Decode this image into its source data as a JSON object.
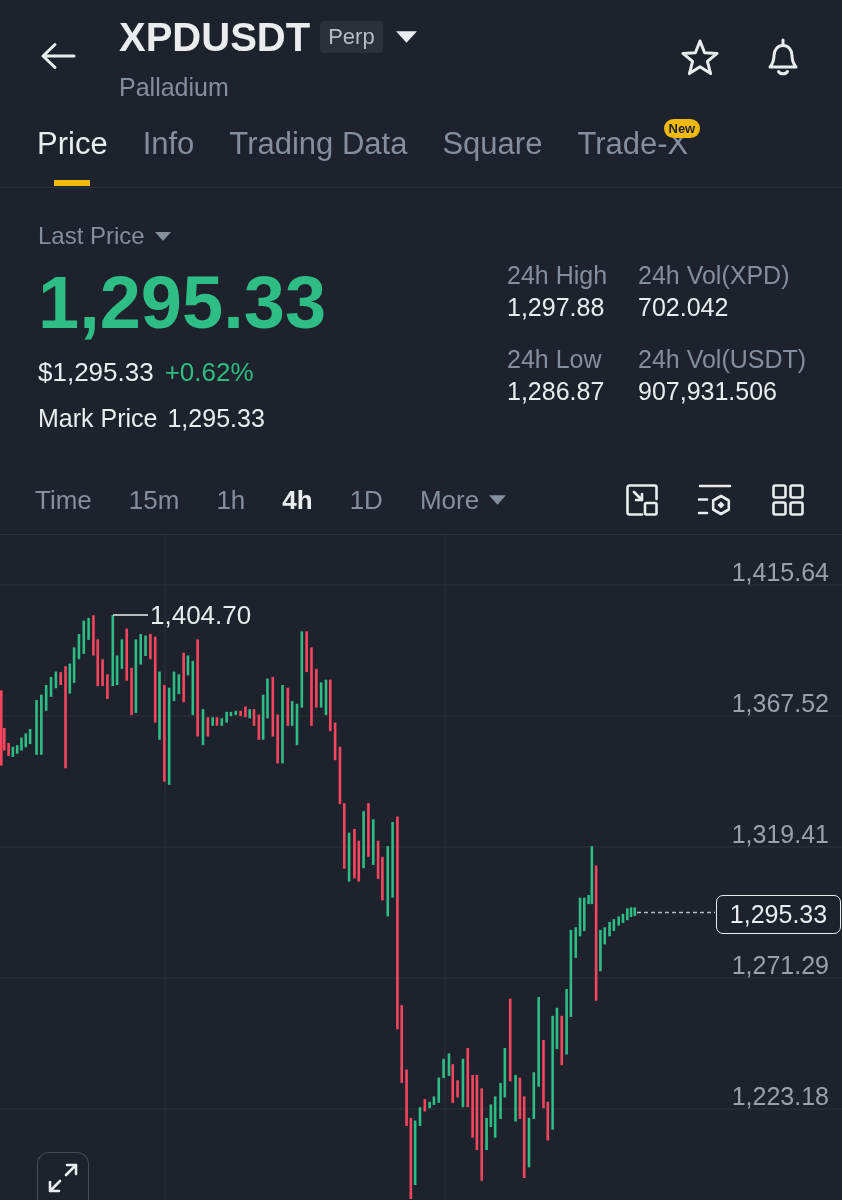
{
  "header": {
    "symbol": "XPDUSDT",
    "contract_badge": "Perp",
    "subtitle": "Palladium"
  },
  "tabs": [
    {
      "label": "Price",
      "selected": true
    },
    {
      "label": "Info",
      "selected": false
    },
    {
      "label": "Trading Data",
      "selected": false
    },
    {
      "label": "Square",
      "selected": false
    },
    {
      "label": "Trade-X",
      "selected": false,
      "badge": "New"
    }
  ],
  "price_panel": {
    "price_type": "Last Price",
    "last_price": "1,295.33",
    "rising": true,
    "usd_price": "$1,295.33",
    "change": "+0.62%",
    "mark_price_label": "Mark Price",
    "mark_price": "1,295.33"
  },
  "stats": [
    {
      "label": "24h High",
      "value": "1,297.88"
    },
    {
      "label": "24h Vol(XPD)",
      "value": "702.042"
    },
    {
      "label": "24h Low",
      "value": "1,286.87"
    },
    {
      "label": "24h Vol(USDT)",
      "value": "907,931.506"
    }
  ],
  "intervals": [
    {
      "label": "Time",
      "kind": "interval",
      "selected": false
    },
    {
      "label": "15m",
      "kind": "interval",
      "selected": false
    },
    {
      "label": "1h",
      "kind": "interval",
      "selected": false
    },
    {
      "label": "4h",
      "kind": "interval",
      "selected": true
    },
    {
      "label": "1D",
      "kind": "interval",
      "selected": false
    },
    {
      "label": "More",
      "kind": "menu",
      "selected": false
    }
  ],
  "chart": {
    "price_axis": [
      "1,415.64",
      "1,367.52",
      "1,319.41",
      "1,271.29",
      "1,223.18"
    ],
    "high_marker": "1,404.70",
    "current_price": "1,295.33"
  }
}
